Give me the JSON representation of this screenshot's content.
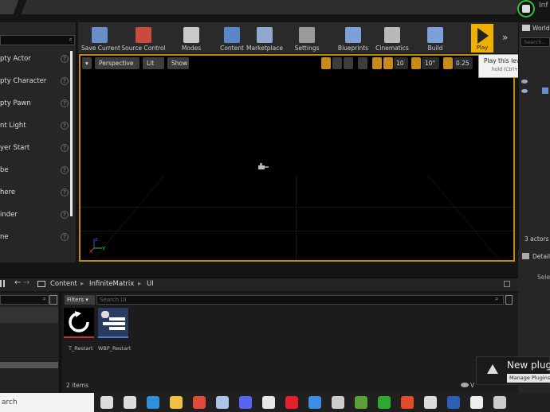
{
  "window": {
    "info_tab": "Inf"
  },
  "place_actors": {
    "items": [
      {
        "label": "pty Actor"
      },
      {
        "label": "pty Character"
      },
      {
        "label": "pty Pawn"
      },
      {
        "label": "nt Light"
      },
      {
        "label": "yer Start"
      },
      {
        "label": "be"
      },
      {
        "label": "here"
      },
      {
        "label": "inder"
      },
      {
        "label": "ne"
      }
    ],
    "help_glyph": "?"
  },
  "toolbar": {
    "buttons": [
      {
        "label": "Save Current",
        "icon": "save-icon",
        "color": "#6a8fc8"
      },
      {
        "label": "Source Control",
        "icon": "source-control-icon",
        "color": "#c84b3c"
      },
      {
        "label": "Modes",
        "icon": "modes-icon",
        "color": "#c9c9c9"
      },
      {
        "label": "Content",
        "icon": "content-icon",
        "color": "#5d86c8"
      },
      {
        "label": "Marketplace",
        "icon": "marketplace-icon",
        "color": "#8fa9cf"
      },
      {
        "label": "Settings",
        "icon": "settings-icon",
        "color": "#9a9a9a"
      },
      {
        "label": "Blueprints",
        "icon": "blueprints-icon",
        "color": "#7ea0d8"
      },
      {
        "label": "Cinematics",
        "icon": "cinematics-icon",
        "color": "#b9b9b9"
      },
      {
        "label": "Build",
        "icon": "build-icon",
        "color": "#7ea0d8"
      }
    ],
    "play_label": "Play",
    "more_glyph": "»"
  },
  "tooltip": {
    "text": "Play this level in a new wi",
    "sub": "hold (Ctrl+Alt) for r"
  },
  "viewport": {
    "dropdown_glyph": "▾",
    "perspective": "Perspective",
    "lit": "Lit",
    "show": "Show",
    "grid_snap": "10",
    "rot_snap": "10°",
    "scale_snap": "0.25",
    "accent": "#c28a0a",
    "axis_labels": {
      "x": "x",
      "y": "Y",
      "z": "z"
    }
  },
  "world_outliner": {
    "title": "World C",
    "search_placeholder": "Search...",
    "actors_count": "3 actors"
  },
  "details": {
    "title": "Details",
    "select_text": "Selec"
  },
  "content_browser": {
    "breadcrumb": [
      "Content",
      "InfiniteMatrix",
      "UI"
    ],
    "filters_label": "Filters ▾",
    "search_placeholder": "Search UI",
    "assets": [
      {
        "name": "T_Restart",
        "icon": "restart-texture-icon"
      },
      {
        "name": "WBP_Restart",
        "icon": "widget-blueprint-icon"
      }
    ],
    "items_count": "2 items",
    "view_options": "V"
  },
  "notification": {
    "title": "New plug",
    "link": "Manage Plugins"
  },
  "taskbar": {
    "search_text": "arch",
    "icons": [
      {
        "name": "task-view-icon",
        "color": "#dddddd"
      },
      {
        "name": "widgets-icon",
        "color": "#dddddd"
      },
      {
        "name": "edge-icon",
        "color": "#2f8fd8"
      },
      {
        "name": "file-explorer-icon",
        "color": "#f0c040"
      },
      {
        "name": "chrome-icon",
        "color": "#e04a3a"
      },
      {
        "name": "steam-icon",
        "color": "#a9c6e8"
      },
      {
        "name": "discord-icon",
        "color": "#5865f2"
      },
      {
        "name": "store-icon",
        "color": "#e8e8e8"
      },
      {
        "name": "opera-icon",
        "color": "#e0202a"
      },
      {
        "name": "mail-icon",
        "color": "#3a8ee8"
      },
      {
        "name": "epic-icon",
        "color": "#cccccc"
      },
      {
        "name": "minecraft-icon",
        "color": "#5aa03a"
      },
      {
        "name": "xbox-icon",
        "color": "#2fa82f"
      },
      {
        "name": "office-icon",
        "color": "#e24b2a"
      },
      {
        "name": "photos-icon",
        "color": "#dddddd"
      },
      {
        "name": "word-icon",
        "color": "#2b5fb8"
      },
      {
        "name": "unreal-icon",
        "color": "#eeeeee"
      },
      {
        "name": "app-icon",
        "color": "#cccccc"
      }
    ],
    "tray_glyph": "^"
  }
}
